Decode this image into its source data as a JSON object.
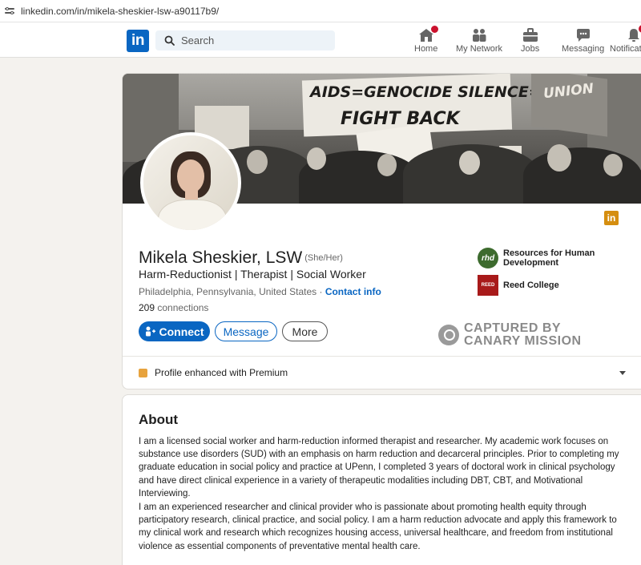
{
  "browser": {
    "url": "linkedin.com/in/mikela-sheskier-lsw-a90117b9/"
  },
  "nav": {
    "logo": "in",
    "search_placeholder": "Search",
    "items": [
      {
        "label": "Home",
        "badge": ""
      },
      {
        "label": "My Network",
        "badge": ""
      },
      {
        "label": "Jobs",
        "badge": ""
      },
      {
        "label": "Messaging",
        "badge": ""
      },
      {
        "label": "Notifications",
        "badge": "1"
      }
    ]
  },
  "banner": {
    "sign_text_1": "AIDS=GENOCIDE SILENCE=DEATH",
    "sign_text_2": "FIGHT BACK",
    "flag_text": "UNION"
  },
  "profile": {
    "name": "Mikela Sheskier, LSW",
    "pronouns": "(She/Her)",
    "headline": "Harm-Reductionist | Therapist | Social Worker",
    "location": "Philadelphia, Pennsylvania, United States",
    "separator": " · ",
    "contact_info": "Contact info",
    "connections_count": "209",
    "connections_label": "connections",
    "company_badge": "in",
    "buttons": {
      "connect": "Connect",
      "message": "Message",
      "more": "More"
    },
    "experience": [
      {
        "name_line1": "Resources for Human",
        "name_line2": "Development",
        "logo_text": "rhd"
      },
      {
        "name_line1": "Reed College",
        "name_line2": "",
        "logo_text": "REED"
      }
    ],
    "watermark_line1": "CAPTURED BY",
    "watermark_line2": "CANARY MISSION",
    "premium_text": "Profile enhanced with Premium"
  },
  "about": {
    "title": "About",
    "paragraph1": "I am a licensed social worker and harm-reduction informed therapist and researcher. My academic work focuses on substance use disorders (SUD) with an emphasis on harm reduction and decarceral principles. Prior to completing my graduate education in social policy and practice at UPenn, I completed 3 years of doctoral work in clinical psychology and have direct clinical experience in a variety of therapeutic modalities including DBT, CBT, and Motivational Interviewing.",
    "paragraph2": "I am an experienced researcher and clinical provider who is passionate about promoting health equity through participatory research, clinical practice, and social policy. I am a harm reduction advocate and apply this framework to my clinical work and research which recognizes housing access, universal healthcare, and freedom from institutional violence as essential components of preventative mental health care."
  },
  "colors": {
    "brand": "#0a66c2",
    "badge": "#cb112d",
    "premium": "#e7a33e"
  }
}
